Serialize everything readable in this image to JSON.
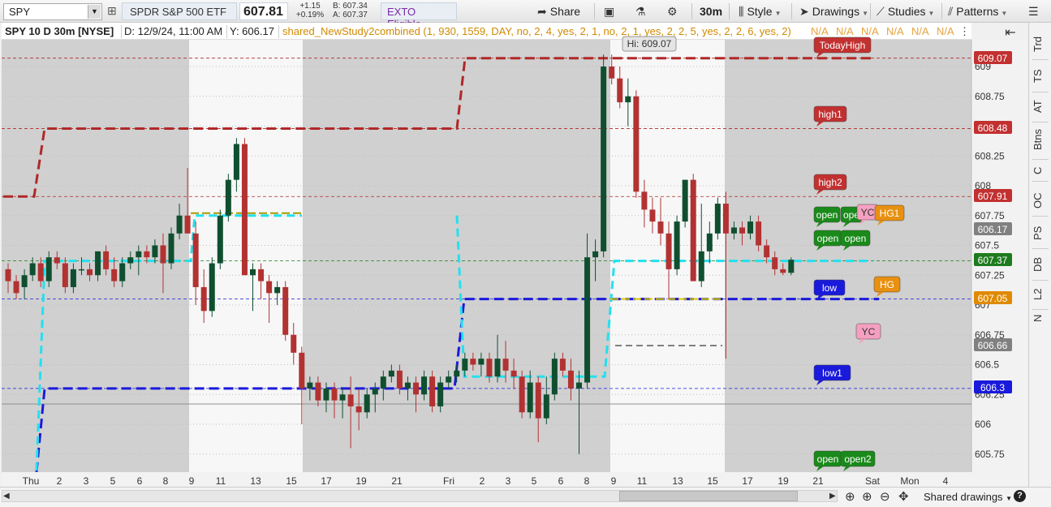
{
  "toolbar": {
    "symbol": "SPY",
    "description": "SPDR S&P 500 ETF",
    "last": "607.81",
    "change": "+1.15",
    "change_pct": "+0.19%",
    "bid": "B: 607.34",
    "ask": "A: 607.37",
    "exto": "EXTO Eligible",
    "share": "Share",
    "timeframe": "30m",
    "style": "Style",
    "drawings": "Drawings",
    "studies": "Studies",
    "patterns": "Patterns"
  },
  "infobar": {
    "title": "SPY 10 D 30m [NYSE]",
    "date": "D: 12/9/24, 11:00 AM",
    "y": "Y: 606.17",
    "study": "shared_NewStudy2combined (1, 930, 1559, DAY, no, 2, 4, yes, 2, 1, no, 2, 1, yes, 2, 2, 5, yes, 2, 2, 6, yes, 2)",
    "na_values": [
      "N/A",
      "N/A",
      "N/A",
      "N/A",
      "N/A",
      "N/A"
    ]
  },
  "right_tabs": [
    "Trd",
    "TS",
    "AT",
    "Btns",
    "C",
    "OC",
    "PS",
    "DB",
    "L2",
    "N"
  ],
  "chart_data": {
    "type": "candlestick",
    "symbol": "SPY",
    "interval": "30m",
    "ylim": [
      605.6,
      609.4
    ],
    "y_ticks": [
      "609",
      "608.75",
      "608.5",
      "608.25",
      "608",
      "607.75",
      "607.5",
      "607.25",
      "607",
      "606.75",
      "606.5",
      "606.25",
      "606",
      "605.75"
    ],
    "x_labels": [
      "Thu",
      "2",
      "3",
      "5",
      "6",
      "8",
      "9",
      "11",
      "13",
      "15",
      "17",
      "19",
      "21",
      "Fri",
      "2",
      "3",
      "5",
      "6",
      "8",
      "9",
      "11",
      "13",
      "15",
      "17",
      "19",
      "21",
      "Sat",
      "Mon",
      "4"
    ],
    "price_labels": [
      {
        "value": "609.07",
        "color": "#c23030"
      },
      {
        "value": "608.48",
        "color": "#c23030"
      },
      {
        "value": "607.91",
        "color": "#c23030"
      },
      {
        "value": "606.17",
        "color": "#808080"
      },
      {
        "value": "607.37",
        "color": "#1e7a1e"
      },
      {
        "value": "607.05",
        "color": "#e08a00"
      },
      {
        "value": "606.66",
        "color": "#808080"
      },
      {
        "value": "606.3",
        "color": "#1a1adc"
      }
    ],
    "high_callout": "Hi: 609.07",
    "bubbles": [
      {
        "text": "TodayHigh",
        "color": "#c23030"
      },
      {
        "text": "high1",
        "color": "#c23030"
      },
      {
        "text": "high2",
        "color": "#c23030"
      },
      {
        "text": "open",
        "color": "#1a8a1a"
      },
      {
        "text": "ope",
        "color": "#1a8a1a"
      },
      {
        "text": "YC",
        "color": "#f5a0c0"
      },
      {
        "text": "HG1",
        "color": "#e89010"
      },
      {
        "text": "open",
        "color": "#1a8a1a"
      },
      {
        "text": "open",
        "color": "#1a8a1a"
      },
      {
        "text": "low",
        "color": "#1a1adc"
      },
      {
        "text": "HG",
        "color": "#e89010"
      },
      {
        "text": "YC",
        "color": "#f5a0c0"
      },
      {
        "text": "low1",
        "color": "#1a1adc"
      },
      {
        "text": "open",
        "color": "#1a8a1a"
      },
      {
        "text": "open2",
        "color": "#1a8a1a"
      }
    ],
    "candles": [
      [
        607.3,
        607.35,
        607.1,
        607.2
      ],
      [
        607.2,
        607.25,
        607.05,
        607.1
      ],
      [
        607.15,
        607.3,
        607.05,
        607.25
      ],
      [
        607.25,
        607.4,
        607.2,
        607.35
      ],
      [
        607.35,
        607.4,
        607.15,
        607.2
      ],
      [
        607.2,
        607.45,
        607.15,
        607.4
      ],
      [
        607.4,
        607.45,
        607.3,
        607.35
      ],
      [
        607.35,
        607.4,
        607.1,
        607.15
      ],
      [
        607.15,
        607.35,
        607.1,
        607.3
      ],
      [
        607.3,
        607.4,
        607.25,
        607.3
      ],
      [
        607.3,
        607.35,
        607.2,
        607.25
      ],
      [
        607.25,
        607.45,
        607.2,
        607.45
      ],
      [
        607.45,
        607.5,
        607.25,
        607.3
      ],
      [
        607.3,
        607.4,
        607.15,
        607.2
      ],
      [
        607.2,
        607.4,
        607.15,
        607.35
      ],
      [
        607.35,
        607.45,
        607.3,
        607.4
      ],
      [
        607.4,
        607.5,
        607.25,
        607.45
      ],
      [
        607.45,
        607.5,
        607.35,
        607.4
      ],
      [
        607.4,
        607.55,
        607.35,
        607.5
      ],
      [
        607.5,
        607.6,
        607.1,
        607.35
      ],
      [
        607.35,
        607.65,
        607.3,
        607.6
      ],
      [
        607.6,
        607.85,
        607.55,
        607.75
      ],
      [
        607.75,
        608.15,
        607.6,
        607.6
      ],
      [
        607.6,
        607.7,
        607.0,
        607.15
      ],
      [
        607.15,
        607.3,
        606.85,
        606.95
      ],
      [
        606.95,
        607.4,
        606.9,
        607.35
      ],
      [
        607.35,
        607.8,
        607.3,
        607.75
      ],
      [
        607.75,
        608.1,
        607.7,
        608.05
      ],
      [
        608.05,
        608.4,
        607.95,
        608.35
      ],
      [
        608.35,
        608.4,
        607.35,
        607.25
      ],
      [
        607.25,
        607.35,
        606.95,
        607.3
      ],
      [
        607.3,
        607.35,
        607.05,
        607.2
      ],
      [
        607.2,
        607.25,
        606.85,
        607.1
      ],
      [
        607.1,
        607.2,
        607.0,
        607.15
      ],
      [
        607.15,
        607.2,
        606.7,
        606.75
      ],
      [
        606.75,
        606.85,
        606.5,
        606.6
      ],
      [
        606.6,
        606.65,
        606.0,
        606.3
      ],
      [
        606.3,
        606.4,
        606.2,
        606.35
      ],
      [
        606.35,
        606.4,
        606.15,
        606.2
      ],
      [
        606.2,
        606.35,
        606.1,
        606.3
      ],
      [
        606.3,
        606.35,
        606.05,
        606.2
      ],
      [
        606.2,
        606.3,
        606.05,
        606.25
      ],
      [
        606.25,
        606.4,
        605.8,
        606.15
      ],
      [
        606.15,
        606.3,
        605.95,
        606.1
      ],
      [
        606.1,
        606.3,
        606.05,
        606.25
      ],
      [
        606.25,
        606.35,
        606.1,
        606.3
      ],
      [
        606.3,
        606.45,
        606.2,
        606.4
      ],
      [
        606.4,
        606.5,
        606.35,
        606.45
      ],
      [
        606.45,
        606.5,
        606.25,
        606.3
      ],
      [
        606.3,
        606.4,
        606.2,
        606.35
      ],
      [
        606.35,
        606.4,
        606.1,
        606.25
      ],
      [
        606.25,
        606.45,
        606.2,
        606.4
      ],
      [
        606.4,
        606.45,
        606.1,
        606.15
      ],
      [
        606.15,
        606.4,
        606.1,
        606.35
      ],
      [
        606.35,
        606.45,
        606.3,
        606.4
      ],
      [
        606.4,
        606.5,
        606.35,
        606.45
      ],
      [
        606.45,
        606.6,
        606.4,
        606.55
      ],
      [
        606.55,
        606.6,
        606.45,
        606.5
      ],
      [
        606.5,
        606.6,
        606.4,
        606.55
      ],
      [
        606.55,
        606.6,
        606.35,
        606.4
      ],
      [
        606.4,
        606.75,
        606.35,
        606.55
      ],
      [
        606.55,
        606.7,
        606.35,
        606.45
      ],
      [
        606.45,
        606.55,
        606.3,
        606.4
      ],
      [
        606.4,
        606.45,
        606.05,
        606.1
      ],
      [
        606.1,
        606.45,
        606.05,
        606.35
      ],
      [
        606.35,
        606.4,
        605.85,
        606.05
      ],
      [
        606.05,
        606.4,
        606.0,
        606.25
      ],
      [
        606.25,
        606.6,
        606.2,
        606.55
      ],
      [
        606.55,
        606.6,
        606.4,
        606.45
      ],
      [
        606.45,
        606.55,
        606.2,
        606.3
      ],
      [
        606.3,
        606.45,
        605.75,
        606.35
      ],
      [
        606.35,
        607.6,
        606.3,
        607.4
      ],
      [
        607.4,
        607.55,
        607.2,
        607.45
      ],
      [
        607.45,
        609.1,
        607.4,
        609.0
      ],
      [
        609.0,
        609.1,
        608.85,
        608.9
      ],
      [
        608.9,
        609.0,
        608.65,
        608.7
      ],
      [
        608.7,
        608.9,
        608.5,
        608.75
      ],
      [
        608.75,
        608.8,
        607.9,
        607.95
      ],
      [
        607.95,
        608.05,
        607.65,
        607.8
      ],
      [
        607.8,
        607.9,
        607.6,
        607.7
      ],
      [
        607.7,
        607.9,
        607.5,
        607.6
      ],
      [
        607.6,
        607.7,
        607.05,
        607.3
      ],
      [
        607.3,
        607.75,
        607.25,
        607.7
      ],
      [
        607.7,
        608.05,
        607.65,
        608.05
      ],
      [
        608.05,
        608.1,
        607.2,
        607.2
      ],
      [
        607.2,
        607.85,
        607.15,
        607.45
      ],
      [
        607.45,
        607.7,
        607.35,
        607.6
      ],
      [
        607.6,
        607.9,
        607.55,
        607.85
      ],
      [
        607.85,
        607.95,
        606.55,
        607.6
      ],
      [
        607.6,
        607.7,
        607.55,
        607.65
      ],
      [
        607.65,
        607.7,
        607.5,
        607.6
      ],
      [
        607.6,
        607.75,
        607.55,
        607.7
      ],
      [
        607.7,
        607.75,
        607.45,
        607.5
      ],
      [
        607.5,
        607.55,
        607.35,
        607.4
      ],
      [
        607.4,
        607.45,
        607.25,
        607.3
      ],
      [
        607.3,
        607.35,
        607.25,
        607.27
      ],
      [
        607.27,
        607.4,
        607.25,
        607.38
      ]
    ]
  }
}
